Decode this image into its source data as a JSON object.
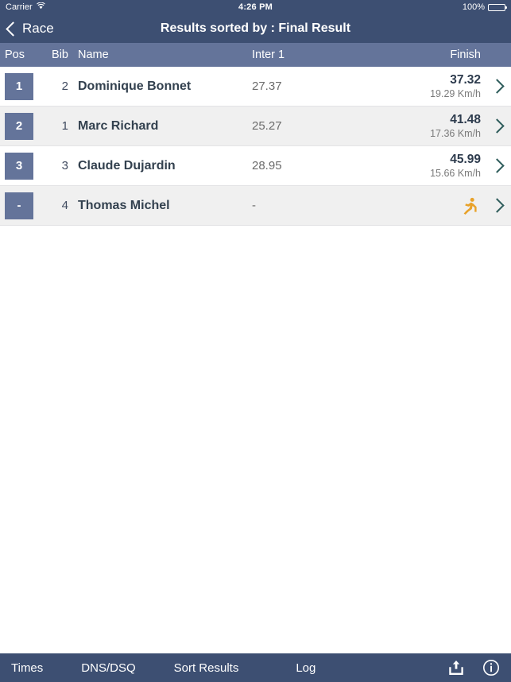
{
  "status_bar": {
    "carrier": "Carrier",
    "wifi_icon": "wifi-icon",
    "time": "4:26 PM",
    "battery_percent": "100%",
    "battery_icon": "battery-full-icon"
  },
  "nav_bar": {
    "back_icon": "chevron-left-icon",
    "back_label": "Race",
    "title": "Results sorted by : Final Result"
  },
  "table": {
    "columns": {
      "pos": "Pos",
      "bib": "Bib",
      "name": "Name",
      "inter1": "Inter 1",
      "finish": "Finish"
    },
    "rows": [
      {
        "position": "1",
        "bib": "2",
        "name": "Dominique Bonnet",
        "inter1": "27.37",
        "finish": "37.32",
        "speed": "19.29 Km/h",
        "status_icon": null,
        "chevron_icon": "chevron-right-icon"
      },
      {
        "position": "2",
        "bib": "1",
        "name": "Marc Richard",
        "inter1": "25.27",
        "finish": "41.48",
        "speed": "17.36 Km/h",
        "status_icon": null,
        "chevron_icon": "chevron-right-icon"
      },
      {
        "position": "3",
        "bib": "3",
        "name": "Claude Dujardin",
        "inter1": "28.95",
        "finish": "45.99",
        "speed": "15.66 Km/h",
        "status_icon": null,
        "chevron_icon": "chevron-right-icon"
      },
      {
        "position": "-",
        "bib": "4",
        "name": "Thomas Michel",
        "inter1": "-",
        "finish": "",
        "speed": "",
        "status_icon": "runner-icon",
        "chevron_icon": "chevron-right-icon"
      }
    ]
  },
  "toolbar": {
    "times": "Times",
    "dns_dsq": "DNS/DSQ",
    "sort_results": "Sort Results",
    "log": "Log",
    "share_icon": "share-upload-icon",
    "info_icon": "info-circle-icon"
  },
  "colors": {
    "nav_bar": "#3d4f72",
    "table_header": "#64749a",
    "badge": "#64749a",
    "row_alt": "#f0f0f0",
    "chevron": "#2f5d5c",
    "runner_accent": "#e8a22a",
    "name_text": "#33414f"
  }
}
